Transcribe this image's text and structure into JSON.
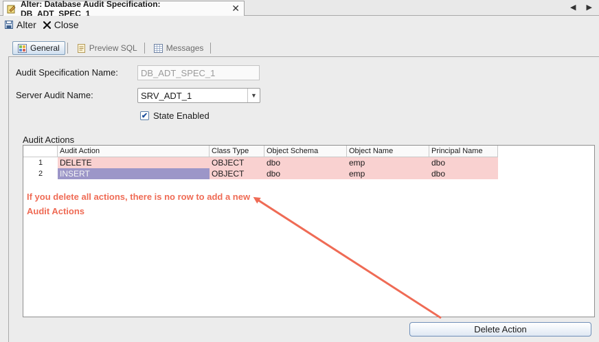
{
  "window": {
    "tab_title": "Alter: Database Audit Specification: DB_ADT_SPEC_1",
    "tab_close": "✕",
    "nav_arrows": "◀ ▶"
  },
  "toolbar": {
    "alter_label": "Alter",
    "close_label": "Close"
  },
  "subtabs": [
    {
      "label": "General",
      "active": true
    },
    {
      "label": "Preview SQL",
      "active": false
    },
    {
      "label": "Messages",
      "active": false
    }
  ],
  "form": {
    "spec_name_label": "Audit Specification Name:",
    "spec_name_value": "DB_ADT_SPEC_1",
    "server_audit_label": "Server Audit Name:",
    "server_audit_value": "SRV_ADT_1",
    "state_enabled_label": "State Enabled",
    "state_enabled_checked": true
  },
  "audit_actions": {
    "title": "Audit Actions",
    "columns": [
      "Audit Action",
      "Class Type",
      "Object Schema",
      "Object Name",
      "Principal Name"
    ],
    "rows": [
      {
        "num": "1",
        "action": "DELETE",
        "class_type": "OBJECT",
        "schema": "dbo",
        "object": "emp",
        "principal": "dbo",
        "selected": false
      },
      {
        "num": "2",
        "action": "INSERT",
        "class_type": "OBJECT",
        "schema": "dbo",
        "object": "emp",
        "principal": "dbo",
        "selected": true
      }
    ]
  },
  "annotation": {
    "text": "If you delete all actions, there is no row to add a new Audit Actions",
    "color": "#ef6b55"
  },
  "delete_button_label": "Delete Action",
  "colors": {
    "row_bg": "#f9d1d0",
    "selected_cell": "#9c96c8",
    "annotation": "#ef6b55"
  }
}
